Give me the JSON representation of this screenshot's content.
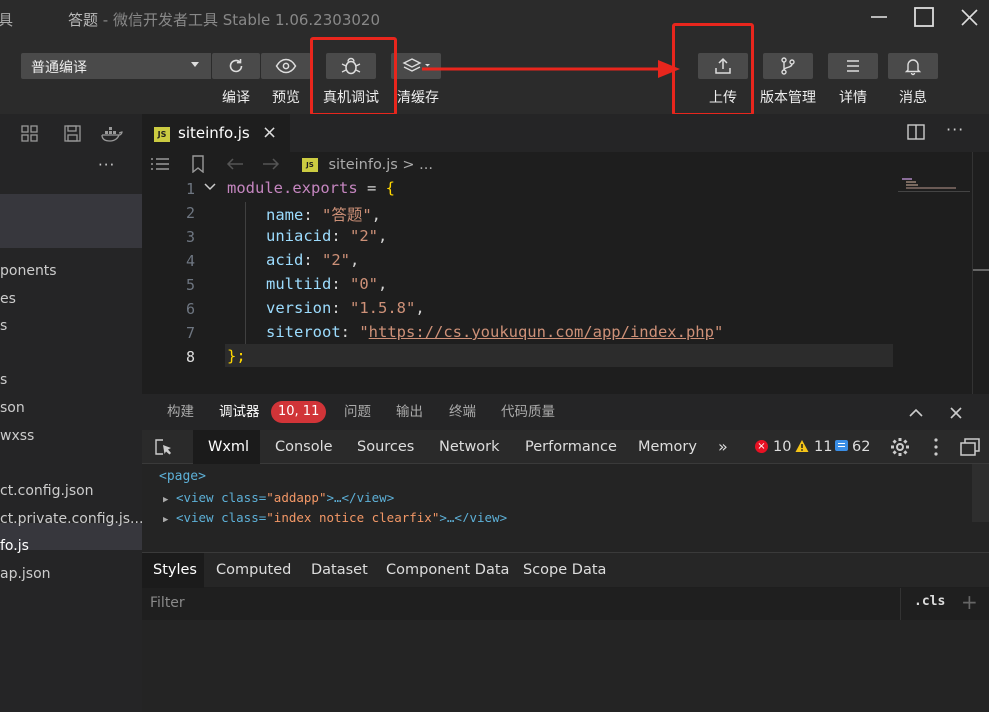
{
  "window": {
    "left_fragment": "具",
    "title": "答题",
    "title_sep": " - ",
    "app_name": "微信开发者工具 Stable 1.06.2303020"
  },
  "toolbar": {
    "compile_mode": "普通编译",
    "compile_label": "编译",
    "preview_label": "预览",
    "remote_debug_label": "真机调试",
    "clear_cache_label": "清缓存",
    "upload_label": "上传",
    "version_label": "版本管理",
    "details_label": "详情",
    "messages_label": "消息"
  },
  "sidebar": {
    "more": "···",
    "files": [
      "ponents",
      "es",
      "s",
      "s",
      "son",
      "wxss",
      "ct.config.json",
      "ct.private.config.js...",
      "fo.js",
      "ap.json"
    ]
  },
  "editor": {
    "tab_icon": "JS",
    "tab_name": "siteinfo.js",
    "tab_close": "×",
    "breadcrumb_file": "siteinfo.js",
    "breadcrumb_rest": " > ...",
    "line_numbers": [
      "1",
      "2",
      "3",
      "4",
      "5",
      "6",
      "7",
      "8"
    ],
    "code": {
      "l1_a": "module.exports",
      "l1_b": " = ",
      "l1_c": "{",
      "l2_k": "name",
      "l2_v": "\"答题\"",
      "l3_k": "uniacid",
      "l3_v": "\"2\"",
      "l4_k": "acid",
      "l4_v": "\"2\"",
      "l5_k": "multiid",
      "l5_v": "\"0\"",
      "l6_k": "version",
      "l6_v": "\"1.5.8\"",
      "l7_k": "siteroot",
      "l7_q1": "\"",
      "l7_url": "https://cs.youkuqun.com/app/index.php",
      "l7_q2": "\"",
      "l8": "};"
    }
  },
  "panel": {
    "tabs": [
      "构建",
      "调试器",
      "问题",
      "输出",
      "终端",
      "代码质量"
    ],
    "badge": "10, 11"
  },
  "devtools": {
    "tabs": [
      "Wxml",
      "Console",
      "Sources",
      "Network",
      "Performance",
      "Memory"
    ],
    "more": "»",
    "errors": "10",
    "warnings": "11",
    "infos": "62",
    "wxml": {
      "line1": "<page>",
      "line2_open": "<view class=",
      "line2_val": "\"addapp\"",
      "line2_close": ">…</view>",
      "line3_open": "<view class=",
      "line3_val": "\"index notice clearfix\"",
      "line3_close": ">…</view>"
    },
    "styles_tabs": [
      "Styles",
      "Computed",
      "Dataset",
      "Component Data",
      "Scope Data"
    ],
    "filter_placeholder": "Filter",
    "cls": ".cls",
    "plus": "+"
  },
  "colors": {
    "highlight_red": "#e8261d",
    "badge_red": "#d13438",
    "accent": "#0e639c"
  }
}
